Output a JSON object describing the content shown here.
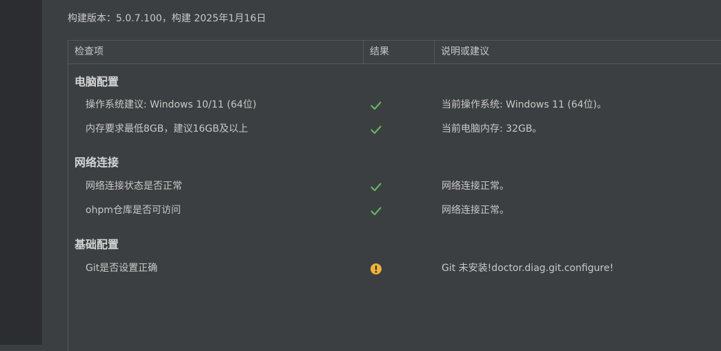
{
  "build_info": "构建版本：5.0.7.100，构建 2025年1月16日",
  "table": {
    "headers": {
      "item": "检查项",
      "result": "结果",
      "note": "说明或建议"
    },
    "groups": [
      {
        "title": "电脑配置",
        "rows": [
          {
            "item": "操作系统建议: Windows 10/11 (64位)",
            "status": "ok",
            "note": "当前操作系统: Windows 11 (64位)。"
          },
          {
            "item": "内存要求最低8GB，建议16GB及以上",
            "status": "ok",
            "note": "当前电脑内存: 32GB。"
          }
        ]
      },
      {
        "title": "网络连接",
        "rows": [
          {
            "item": "网络连接状态是否正常",
            "status": "ok",
            "note": "网络连接正常。"
          },
          {
            "item": "ohpm仓库是否可访问",
            "status": "ok",
            "note": "网络连接正常。"
          }
        ]
      },
      {
        "title": "基础配置",
        "rows": [
          {
            "item": "Git是否设置正确",
            "status": "warning",
            "note": "Git 未安装!doctor.diag.git.configure!"
          }
        ]
      }
    ]
  },
  "colors": {
    "ok": "#5fb85f",
    "warning": "#f0b33a"
  },
  "icons": {
    "ok": "check-icon",
    "warning": "warning-icon"
  }
}
